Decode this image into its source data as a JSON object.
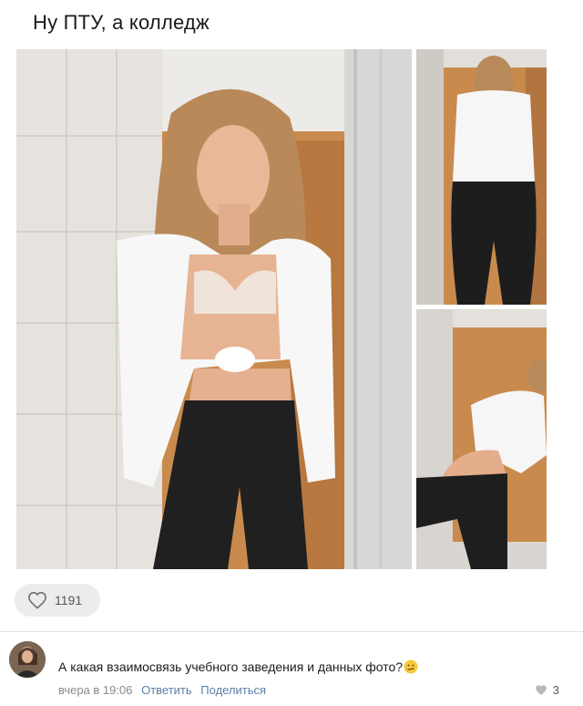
{
  "post": {
    "title": "Ну ПТУ, а колледж",
    "photos": [
      {
        "name": "photo-main"
      },
      {
        "name": "photo-top-right"
      },
      {
        "name": "photo-bottom-right"
      }
    ],
    "like_icon": "heart-icon",
    "likes": "1191"
  },
  "comment": {
    "text": "А какая взаимосвязь учебного заведения и данных фото?",
    "emoji": "confused-face-emoji",
    "time": "вчера в 19:06",
    "reply_label": "Ответить",
    "share_label": "Поделиться",
    "like_icon": "heart-icon",
    "likes": "3"
  },
  "colors": {
    "link": "#5d7fa6",
    "meta": "#8a8a8a",
    "pill_bg": "#ececec"
  }
}
